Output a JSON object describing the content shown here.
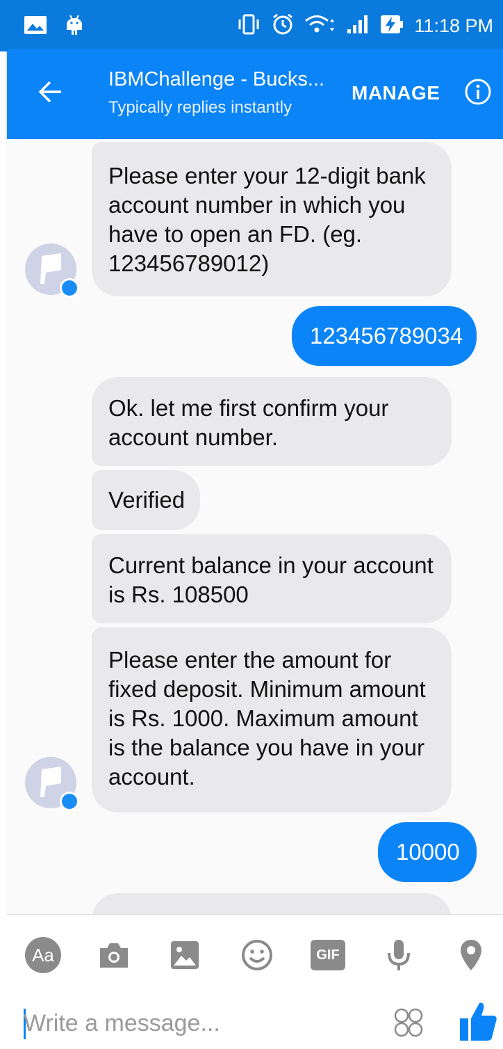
{
  "status_bar": {
    "time": "11:18 PM",
    "icons": [
      "gallery-notification-icon",
      "android-notification-icon",
      "vibrate-icon",
      "alarm-icon",
      "wifi-icon",
      "signal-icon",
      "battery-charging-icon"
    ]
  },
  "header": {
    "title": "IBMChallenge - Bucks...",
    "subtitle": "Typically replies instantly",
    "manage_label": "MANAGE"
  },
  "messages": [
    {
      "from": "bot",
      "text": "Please enter your 12-digit bank account number in which you have to open an FD. (eg. 123456789012)"
    },
    {
      "from": "user",
      "text": "123456789034"
    },
    {
      "from": "bot",
      "text": "Ok. let me first confirm your account number."
    },
    {
      "from": "bot",
      "text": "Verified"
    },
    {
      "from": "bot",
      "text": "Current balance in your account is Rs. 108500"
    },
    {
      "from": "bot",
      "text": "Please enter the amount for fixed deposit. Minimum amount is Rs. 1000. Maximum amount is the balance you have in your account."
    },
    {
      "from": "user",
      "text": "10000"
    }
  ],
  "toolbar": {
    "text_tool_label": "Aa",
    "gif_label": "GIF",
    "icons": [
      "text-format-icon",
      "camera-icon",
      "image-icon",
      "emoji-icon",
      "gif-icon",
      "microphone-icon",
      "location-icon"
    ]
  },
  "composer": {
    "placeholder": "Write a message...",
    "value": ""
  },
  "colors": {
    "status_bar": "#0a7bdc",
    "header": "#0a84f6",
    "outgoing_bubble": "#0a84f6",
    "incoming_bubble": "#e9e9eb",
    "icon_gray": "#8a8a8a"
  }
}
